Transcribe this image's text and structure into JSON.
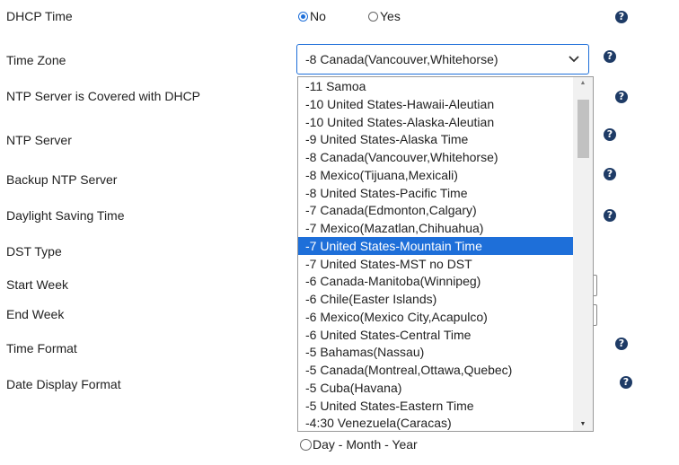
{
  "labels": {
    "dhcp_time": "DHCP Time",
    "time_zone": "Time Zone",
    "ntp_covered": "NTP Server is Covered with DHCP",
    "ntp_server": "NTP Server",
    "backup_ntp": "Backup NTP Server",
    "daylight_saving": "Daylight Saving Time",
    "dst_type": "DST Type",
    "start_week": "Start Week",
    "end_week": "End Week",
    "time_format": "Time Format",
    "date_display_format": "Date Display Format"
  },
  "dhcp_time": {
    "no": "No",
    "yes": "Yes",
    "selected": "No"
  },
  "time_zone": {
    "selected": "-8 Canada(Vancouver,Whitehorse)",
    "highlighted": "-7 United States-Mountain Time",
    "options": [
      "-11 Samoa",
      "-10 United States-Hawaii-Aleutian",
      "-10 United States-Alaska-Aleutian",
      "-9 United States-Alaska Time",
      "-8 Canada(Vancouver,Whitehorse)",
      "-8 Mexico(Tijuana,Mexicali)",
      "-8 United States-Pacific Time",
      "-7 Canada(Edmonton,Calgary)",
      "-7 Mexico(Mazatlan,Chihuahua)",
      "-7 United States-Mountain Time",
      "-7 United States-MST no DST",
      "-6 Canada-Manitoba(Winnipeg)",
      "-6 Chile(Easter Islands)",
      "-6 Mexico(Mexico City,Acapulco)",
      "-6 United States-Central Time",
      "-5 Bahamas(Nassau)",
      "-5 Canada(Montreal,Ottawa,Quebec)",
      "-5 Cuba(Havana)",
      "-5 United States-Eastern Time",
      "-4:30 Venezuela(Caracas)"
    ]
  },
  "date_display_format": {
    "option_visible": "Day - Month - Year"
  },
  "help_glyph": "?",
  "icons": {
    "help": "question-circle-icon",
    "chevron": "chevron-down-icon"
  },
  "colors": {
    "accent": "#1e6fd9",
    "help": "#1e3b66"
  }
}
